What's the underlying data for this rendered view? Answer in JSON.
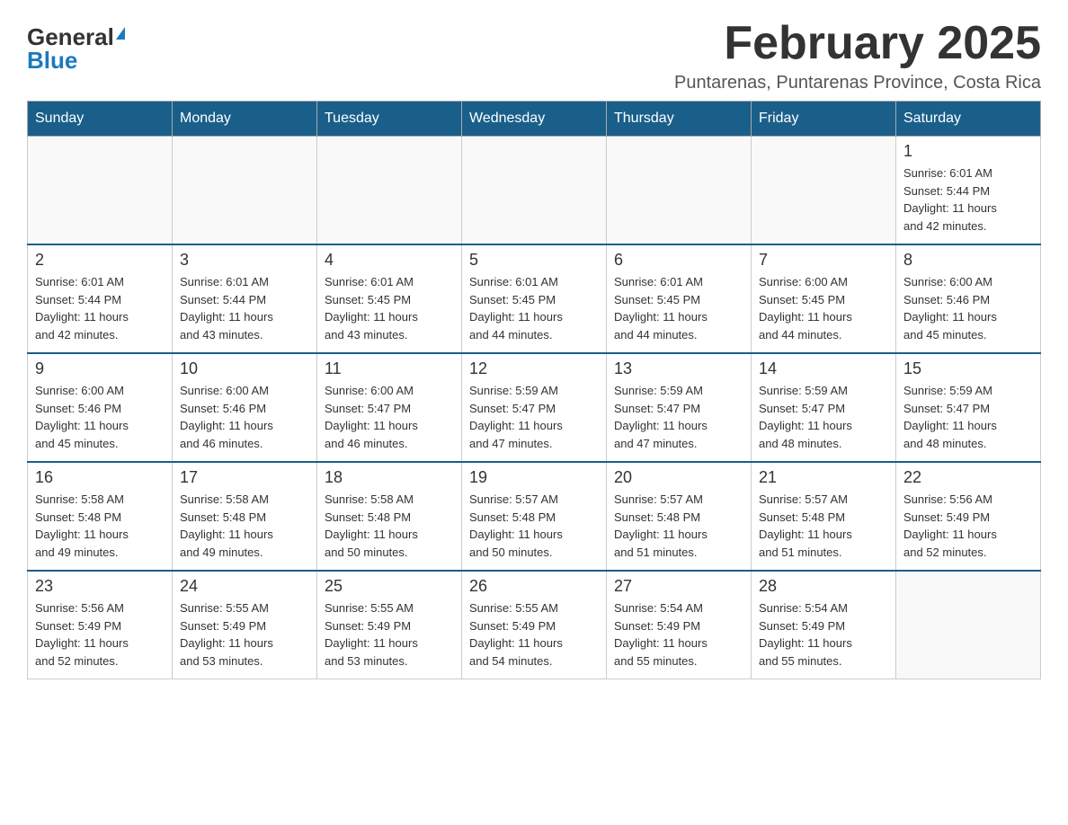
{
  "header": {
    "logo": {
      "general": "General",
      "blue": "Blue",
      "tagline": "GeneralBlue"
    },
    "title": "February 2025",
    "subtitle": "Puntarenas, Puntarenas Province, Costa Rica"
  },
  "days_of_week": [
    "Sunday",
    "Monday",
    "Tuesday",
    "Wednesday",
    "Thursday",
    "Friday",
    "Saturday"
  ],
  "weeks": [
    {
      "days": [
        {
          "number": "",
          "info": "",
          "empty": true
        },
        {
          "number": "",
          "info": "",
          "empty": true
        },
        {
          "number": "",
          "info": "",
          "empty": true
        },
        {
          "number": "",
          "info": "",
          "empty": true
        },
        {
          "number": "",
          "info": "",
          "empty": true
        },
        {
          "number": "",
          "info": "",
          "empty": true
        },
        {
          "number": "1",
          "info": "Sunrise: 6:01 AM\nSunset: 5:44 PM\nDaylight: 11 hours\nand 42 minutes."
        }
      ]
    },
    {
      "days": [
        {
          "number": "2",
          "info": "Sunrise: 6:01 AM\nSunset: 5:44 PM\nDaylight: 11 hours\nand 42 minutes."
        },
        {
          "number": "3",
          "info": "Sunrise: 6:01 AM\nSunset: 5:44 PM\nDaylight: 11 hours\nand 43 minutes."
        },
        {
          "number": "4",
          "info": "Sunrise: 6:01 AM\nSunset: 5:45 PM\nDaylight: 11 hours\nand 43 minutes."
        },
        {
          "number": "5",
          "info": "Sunrise: 6:01 AM\nSunset: 5:45 PM\nDaylight: 11 hours\nand 44 minutes."
        },
        {
          "number": "6",
          "info": "Sunrise: 6:01 AM\nSunset: 5:45 PM\nDaylight: 11 hours\nand 44 minutes."
        },
        {
          "number": "7",
          "info": "Sunrise: 6:00 AM\nSunset: 5:45 PM\nDaylight: 11 hours\nand 44 minutes."
        },
        {
          "number": "8",
          "info": "Sunrise: 6:00 AM\nSunset: 5:46 PM\nDaylight: 11 hours\nand 45 minutes."
        }
      ]
    },
    {
      "days": [
        {
          "number": "9",
          "info": "Sunrise: 6:00 AM\nSunset: 5:46 PM\nDaylight: 11 hours\nand 45 minutes."
        },
        {
          "number": "10",
          "info": "Sunrise: 6:00 AM\nSunset: 5:46 PM\nDaylight: 11 hours\nand 46 minutes."
        },
        {
          "number": "11",
          "info": "Sunrise: 6:00 AM\nSunset: 5:47 PM\nDaylight: 11 hours\nand 46 minutes."
        },
        {
          "number": "12",
          "info": "Sunrise: 5:59 AM\nSunset: 5:47 PM\nDaylight: 11 hours\nand 47 minutes."
        },
        {
          "number": "13",
          "info": "Sunrise: 5:59 AM\nSunset: 5:47 PM\nDaylight: 11 hours\nand 47 minutes."
        },
        {
          "number": "14",
          "info": "Sunrise: 5:59 AM\nSunset: 5:47 PM\nDaylight: 11 hours\nand 48 minutes."
        },
        {
          "number": "15",
          "info": "Sunrise: 5:59 AM\nSunset: 5:47 PM\nDaylight: 11 hours\nand 48 minutes."
        }
      ]
    },
    {
      "days": [
        {
          "number": "16",
          "info": "Sunrise: 5:58 AM\nSunset: 5:48 PM\nDaylight: 11 hours\nand 49 minutes."
        },
        {
          "number": "17",
          "info": "Sunrise: 5:58 AM\nSunset: 5:48 PM\nDaylight: 11 hours\nand 49 minutes."
        },
        {
          "number": "18",
          "info": "Sunrise: 5:58 AM\nSunset: 5:48 PM\nDaylight: 11 hours\nand 50 minutes."
        },
        {
          "number": "19",
          "info": "Sunrise: 5:57 AM\nSunset: 5:48 PM\nDaylight: 11 hours\nand 50 minutes."
        },
        {
          "number": "20",
          "info": "Sunrise: 5:57 AM\nSunset: 5:48 PM\nDaylight: 11 hours\nand 51 minutes."
        },
        {
          "number": "21",
          "info": "Sunrise: 5:57 AM\nSunset: 5:48 PM\nDaylight: 11 hours\nand 51 minutes."
        },
        {
          "number": "22",
          "info": "Sunrise: 5:56 AM\nSunset: 5:49 PM\nDaylight: 11 hours\nand 52 minutes."
        }
      ]
    },
    {
      "days": [
        {
          "number": "23",
          "info": "Sunrise: 5:56 AM\nSunset: 5:49 PM\nDaylight: 11 hours\nand 52 minutes."
        },
        {
          "number": "24",
          "info": "Sunrise: 5:55 AM\nSunset: 5:49 PM\nDaylight: 11 hours\nand 53 minutes."
        },
        {
          "number": "25",
          "info": "Sunrise: 5:55 AM\nSunset: 5:49 PM\nDaylight: 11 hours\nand 53 minutes."
        },
        {
          "number": "26",
          "info": "Sunrise: 5:55 AM\nSunset: 5:49 PM\nDaylight: 11 hours\nand 54 minutes."
        },
        {
          "number": "27",
          "info": "Sunrise: 5:54 AM\nSunset: 5:49 PM\nDaylight: 11 hours\nand 55 minutes."
        },
        {
          "number": "28",
          "info": "Sunrise: 5:54 AM\nSunset: 5:49 PM\nDaylight: 11 hours\nand 55 minutes."
        },
        {
          "number": "",
          "info": "",
          "empty": true
        }
      ]
    }
  ]
}
